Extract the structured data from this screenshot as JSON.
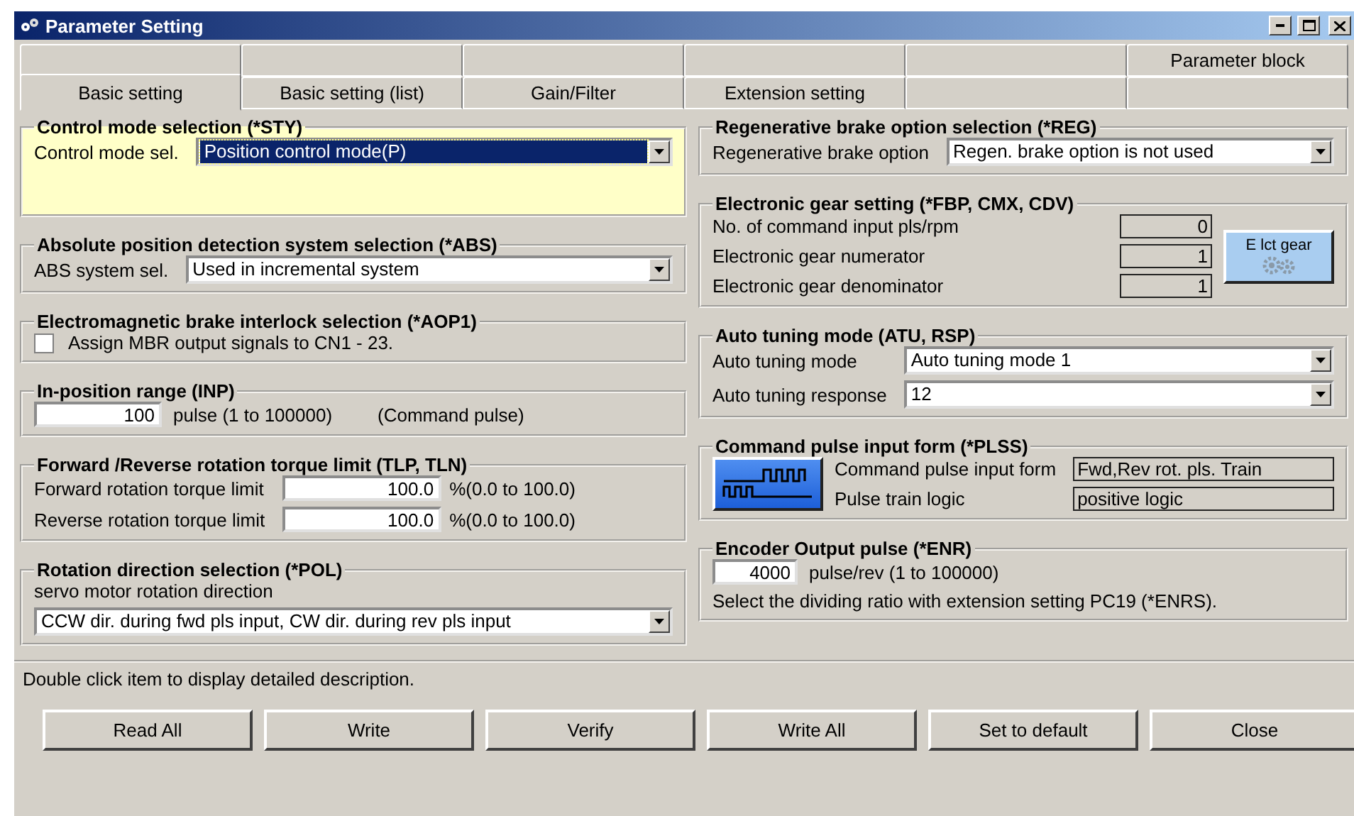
{
  "window": {
    "title": "Parameter Setting"
  },
  "tab_rows": [
    {
      "tabs": [
        {
          "selected": false
        },
        {
          "selected": false
        },
        {
          "selected": false
        },
        {
          "selected": false
        },
        {
          "selected": false
        },
        {
          "label": "Parameter block",
          "selected": false
        }
      ]
    },
    {
      "tabs": [
        {
          "label": "Basic setting",
          "selected": true
        },
        {
          "label": "Basic setting (list)",
          "selected": false
        },
        {
          "label": "Gain/Filter",
          "selected": false
        },
        {
          "label": "Extension setting",
          "selected": false
        },
        {
          "selected": false
        },
        {
          "selected": false
        }
      ]
    }
  ],
  "columns": [
    {
      "groups": [
        {
          "title": "Control mode selection (*STY)",
          "highlighted": true,
          "rows": [
            {
              "kind": "select",
              "label": "Control mode sel.",
              "value": "Position control mode(P)",
              "focused": true
            }
          ]
        },
        {
          "title": "Absolute position detection system selection (*ABS)",
          "highlighted": false,
          "rows": [
            {
              "kind": "select",
              "label": "ABS system sel.",
              "value": "Used in incremental system",
              "focused": false
            }
          ]
        },
        {
          "title": "Electromagnetic brake interlock selection (*AOP1)",
          "highlighted": false,
          "rows": [
            {
              "kind": "checkbox",
              "label": "Assign MBR output signals to CN1 - 23.",
              "checked": false
            }
          ]
        },
        {
          "title": "In-position range (INP)",
          "highlighted": false,
          "rows": [
            {
              "kind": "entry",
              "value": "100",
              "unit": "pulse (1 to 100000)",
              "note": "(Command pulse)"
            }
          ]
        },
        {
          "title": "Forward /Reverse rotation torque limit (TLP, TLN)",
          "highlighted": false,
          "rows": [
            {
              "kind": "entry",
              "label": "Forward rotation torque limit",
              "value": "100.0",
              "unit": "%(0.0 to 100.0)"
            },
            {
              "kind": "entry",
              "label": "Reverse rotation torque limit",
              "value": "100.0",
              "unit": "%(0.0 to 100.0)"
            }
          ]
        },
        {
          "title": "Rotation direction selection (*POL)",
          "highlighted": false,
          "rows": [
            {
              "kind": "caption",
              "text": "servo motor rotation direction"
            },
            {
              "kind": "select",
              "value": "CCW dir. during fwd pls input, CW dir. during rev pls input",
              "focused": false
            }
          ]
        }
      ]
    },
    {
      "groups": [
        {
          "title": "Regenerative brake option selection (*REG)",
          "highlighted": false,
          "rows": [
            {
              "kind": "select",
              "label": "Regenerative brake option",
              "value": "Regen. brake option is not used",
              "focused": false
            }
          ]
        },
        {
          "title": "Electronic gear setting (*FBP, CMX, CDV)",
          "highlighted": false,
          "side_button": {
            "kind": "gear",
            "label": "E lct gear"
          },
          "rows": [
            {
              "kind": "readout",
              "label": "No. of command input pls/rpm",
              "value": "0"
            },
            {
              "kind": "readout",
              "label": "Electronic gear numerator",
              "value": "1"
            },
            {
              "kind": "readout",
              "label": "Electronic gear denominator",
              "value": "1"
            }
          ]
        },
        {
          "title": "Auto tuning mode (ATU, RSP)",
          "highlighted": false,
          "rows": [
            {
              "kind": "select",
              "label": "Auto tuning mode",
              "value": "Auto tuning mode 1",
              "focused": false
            },
            {
              "kind": "select",
              "label": "Auto tuning response",
              "value": "12",
              "focused": false
            }
          ]
        },
        {
          "title": "Command pulse input form (*PLSS)",
          "highlighted": false,
          "side_button": {
            "kind": "pulse"
          },
          "rows": [
            {
              "kind": "readout",
              "label": "Command pulse input form",
              "value": "Fwd,Rev rot. pls. Train"
            },
            {
              "kind": "readout",
              "label": "Pulse train logic",
              "value": "positive logic"
            }
          ]
        },
        {
          "title": "Encoder Output pulse (*ENR)",
          "highlighted": false,
          "rows": [
            {
              "kind": "entry",
              "value": "4000",
              "unit": "pulse/rev (1 to 100000)"
            },
            {
              "kind": "caption",
              "text": "Select the dividing ratio with extension setting PC19 (*ENRS)."
            }
          ]
        }
      ]
    }
  ],
  "status_text": "Double click item to display detailed description.",
  "buttons": [
    {
      "label": "Read All"
    },
    {
      "label": "Write"
    },
    {
      "label": "Verify"
    },
    {
      "label": "Write All"
    },
    {
      "label": "Set to default"
    },
    {
      "label": "Close"
    }
  ]
}
